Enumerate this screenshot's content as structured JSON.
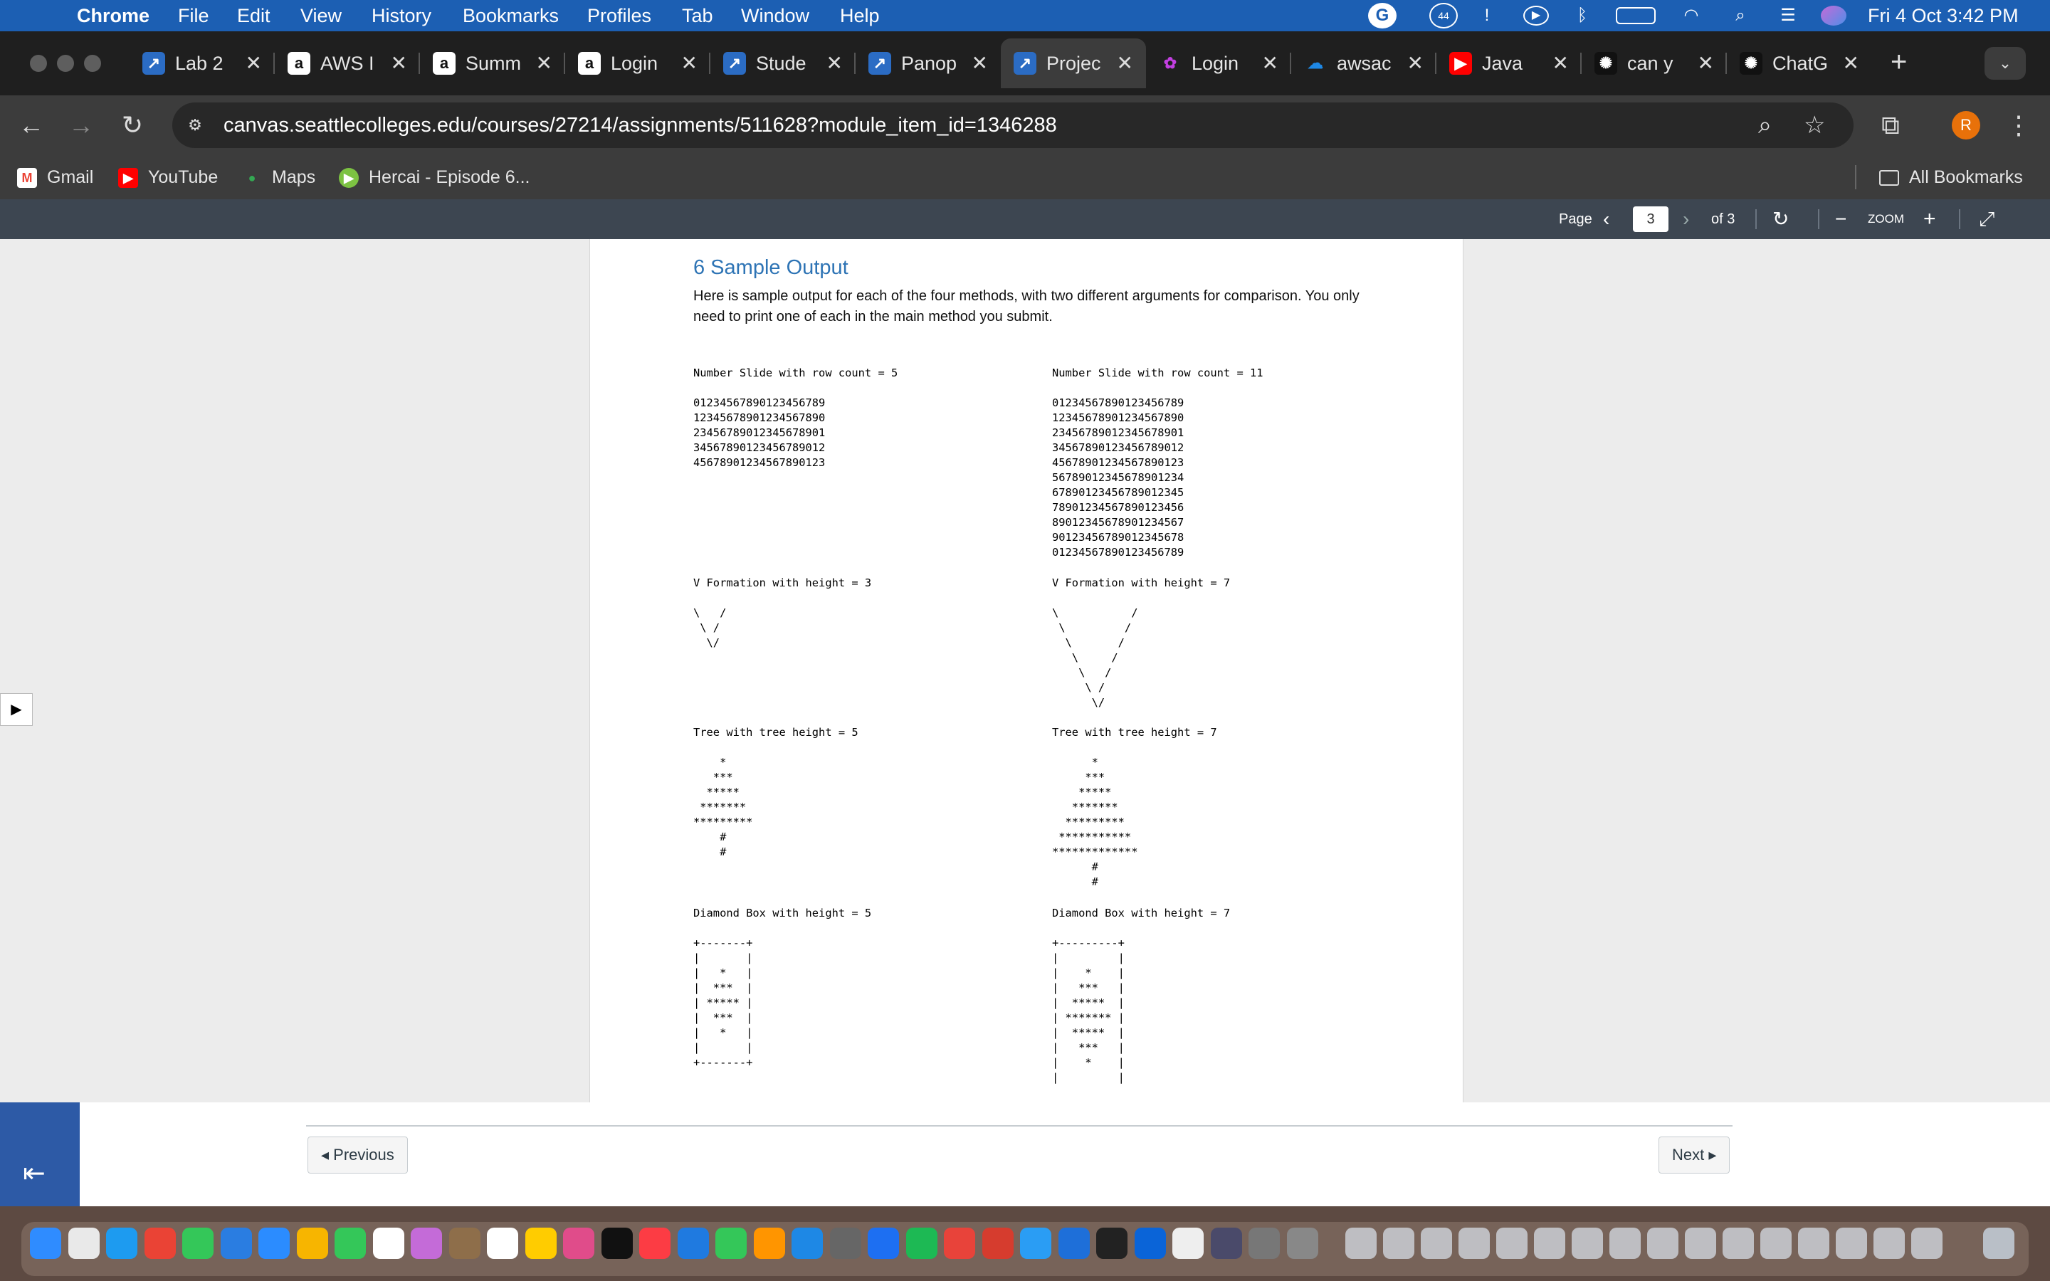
{
  "menubar": {
    "app": "Chrome",
    "items": [
      "File",
      "Edit",
      "View",
      "History",
      "Bookmarks",
      "Profiles",
      "Tab",
      "Window",
      "Help"
    ],
    "clock": "Fri 4 Oct  3:42 PM",
    "badge": "44"
  },
  "tabs": [
    {
      "title": "Lab 2",
      "icon": "canvas-icon"
    },
    {
      "title": "AWS I",
      "icon": "amazon-icon"
    },
    {
      "title": "Summ",
      "icon": "amazon-icon"
    },
    {
      "title": "Login",
      "icon": "amazon-icon"
    },
    {
      "title": "Stude",
      "icon": "canvas-icon"
    },
    {
      "title": "Panop",
      "icon": "canvas-icon"
    },
    {
      "title": "Projec",
      "icon": "canvas-icon",
      "active": true
    },
    {
      "title": "Login",
      "icon": "login-icon"
    },
    {
      "title": "awsac",
      "icon": "cloud-icon"
    },
    {
      "title": "Java",
      "icon": "youtube-icon"
    },
    {
      "title": "can y",
      "icon": "openai-icon"
    },
    {
      "title": "ChatG",
      "icon": "openai-icon"
    }
  ],
  "toolbar": {
    "url": "canvas.seattlecolleges.edu/courses/27214/assignments/511628?module_item_id=1346288",
    "avatar": "R"
  },
  "bookmarks": {
    "items": [
      "Gmail",
      "YouTube",
      "Maps",
      "Hercai - Episode 6..."
    ],
    "all": "All Bookmarks"
  },
  "pdf": {
    "page_label": "Page",
    "page_value": "3",
    "of_label": "of 3",
    "zoom_label": "ZOOM"
  },
  "doc": {
    "heading": "6   Sample Output",
    "intro": "Here is sample output for each of the four methods, with two different arguments for comparison.  You only need to print one of each in the main method you submit.",
    "blocks": {
      "slide5": "Number Slide with row count = 5\n\n01234567890123456789\n12345678901234567890\n23456789012345678901\n34567890123456789012\n45678901234567890123",
      "slide11": "Number Slide with row count = 11\n\n01234567890123456789\n12345678901234567890\n23456789012345678901\n34567890123456789012\n45678901234567890123\n56789012345678901234\n67890123456789012345\n78901234567890123456\n89012345678901234567\n90123456789012345678\n01234567890123456789",
      "v3": "V Formation with height = 3\n\n\\   /\n \\ /\n  \\/",
      "v7": "V Formation with height = 7\n\n\\           /\n \\         /\n  \\       /\n   \\     /\n    \\   /\n     \\ /\n      \\/",
      "tree5": "Tree with tree height = 5\n\n    *\n   ***\n  *****\n *******\n*********\n    #\n    #",
      "tree7": "Tree with tree height = 7\n\n      *\n     ***\n    *****\n   *******\n  *********\n ***********\n*************\n      #\n      #",
      "box5": "Diamond Box with height = 5\n\n+-------+\n|       |\n|   *   |\n|  ***  |\n| ***** |\n|  ***  |\n|   *   |\n|       |\n+-------+",
      "box7": "Diamond Box with height = 7\n\n+---------+\n|         |\n|    *    |\n|   ***   |\n|  *****  |\n| ******* |\n|  *****  |\n|   ***   |\n|    *    |\n|         |"
    }
  },
  "footer": {
    "previous": "◂ Previous",
    "next": "Next ▸"
  }
}
